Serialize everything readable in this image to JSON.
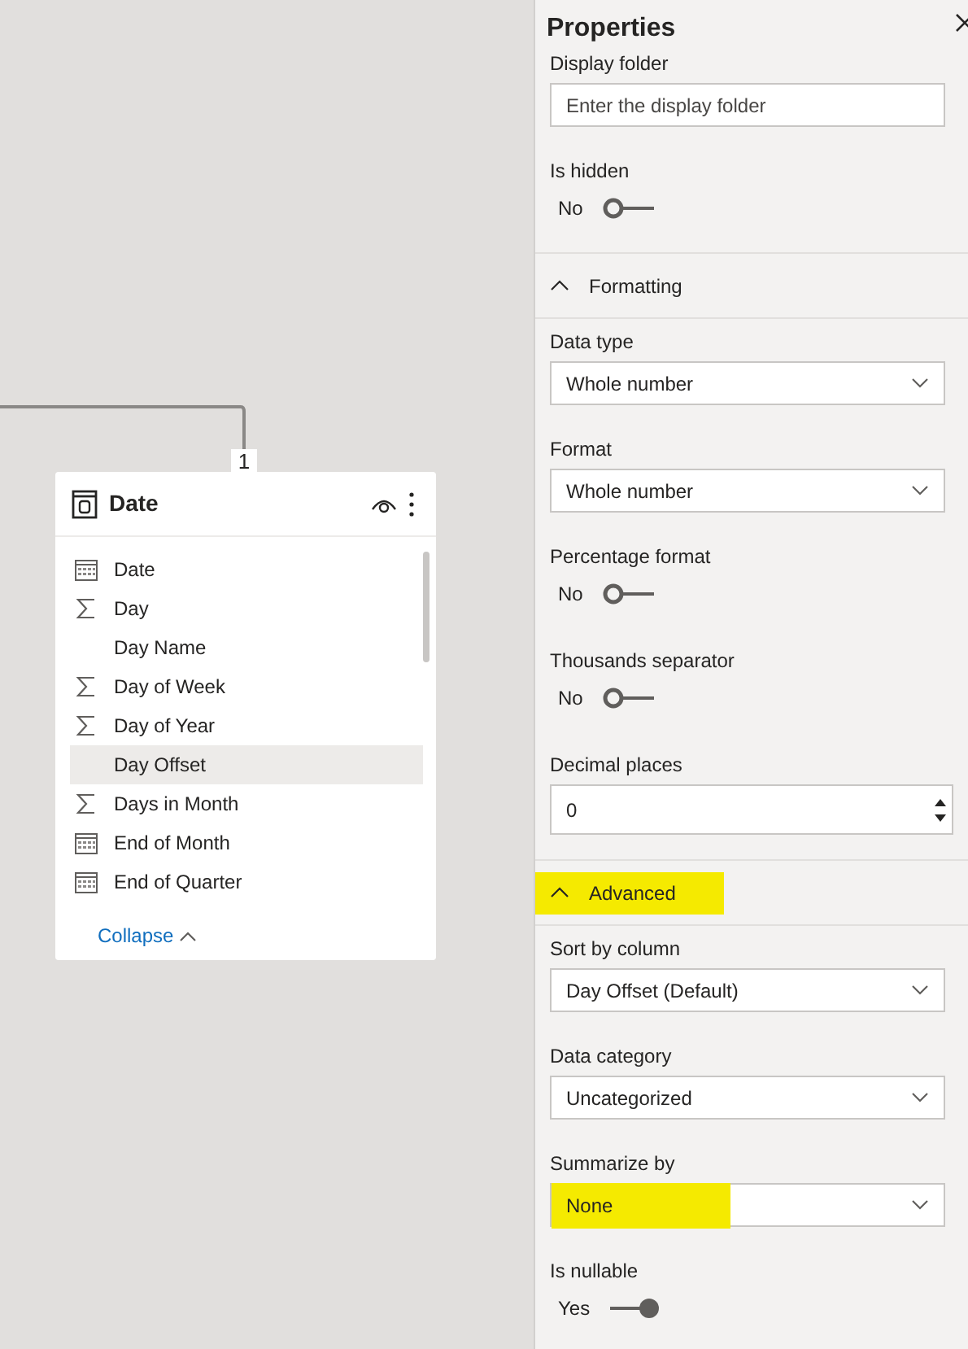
{
  "canvas": {
    "relationship": {
      "cardinality": "1"
    },
    "table_card": {
      "title": "Date",
      "fields": [
        {
          "name": "Date",
          "kind": "calendar",
          "selected": false
        },
        {
          "name": "Day",
          "kind": "sum",
          "selected": false
        },
        {
          "name": "Day Name",
          "kind": "text",
          "selected": false
        },
        {
          "name": "Day of Week",
          "kind": "sum",
          "selected": false
        },
        {
          "name": "Day of Year",
          "kind": "sum",
          "selected": false
        },
        {
          "name": "Day Offset",
          "kind": "text",
          "selected": true
        },
        {
          "name": "Days in Month",
          "kind": "sum",
          "selected": false
        },
        {
          "name": "End of Month",
          "kind": "calendar",
          "selected": false
        },
        {
          "name": "End of Quarter",
          "kind": "calendar",
          "selected": false
        }
      ],
      "collapse": "Collapse"
    }
  },
  "properties": {
    "title": "Properties",
    "items": [
      {
        "kind": "text_input",
        "label": "Display folder",
        "placeholder": "Enter the display folder"
      },
      {
        "kind": "toggle",
        "label": "Is hidden",
        "value": "No",
        "on": false
      },
      {
        "kind": "section",
        "label": "Formatting",
        "expanded": true,
        "highlighted": false
      },
      {
        "kind": "select",
        "label": "Data type",
        "value": "Whole number",
        "highlighted": false
      },
      {
        "kind": "select",
        "label": "Format",
        "value": "Whole number",
        "highlighted": false
      },
      {
        "kind": "toggle",
        "label": "Percentage format",
        "value": "No",
        "on": false
      },
      {
        "kind": "toggle",
        "label": "Thousands separator",
        "value": "No",
        "on": false
      },
      {
        "kind": "number",
        "label": "Decimal places",
        "value": "0"
      },
      {
        "kind": "section",
        "label": "Advanced",
        "expanded": true,
        "highlighted": true
      },
      {
        "kind": "select",
        "label": "Sort by column",
        "value": "Day Offset (Default)",
        "highlighted": false
      },
      {
        "kind": "select",
        "label": "Data category",
        "value": "Uncategorized",
        "highlighted": false
      },
      {
        "kind": "select",
        "label": "Summarize by",
        "value": "None",
        "highlighted": true
      },
      {
        "kind": "toggle",
        "label": "Is nullable",
        "value": "Yes",
        "on": true
      }
    ]
  }
}
